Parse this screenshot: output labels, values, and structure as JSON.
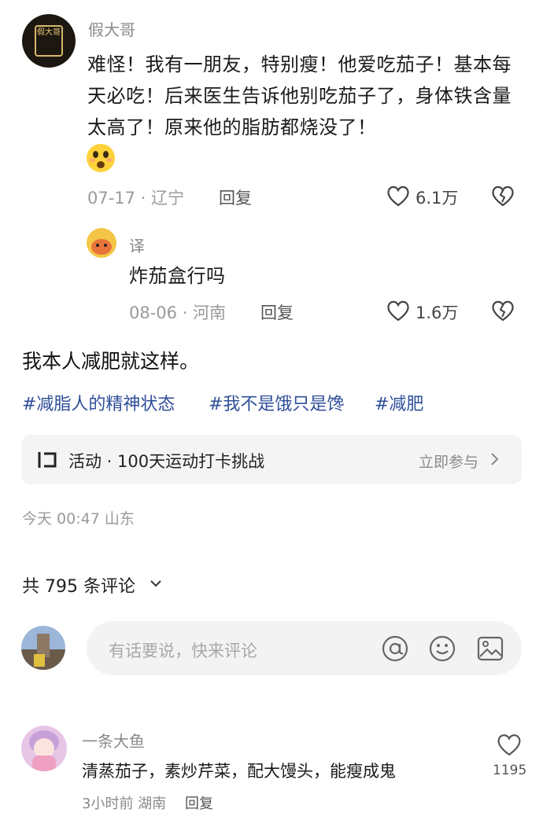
{
  "comment1": {
    "author": "假大哥",
    "avatar_text": "假大哥",
    "text": "难怪！我有一朋友，特别瘦！他爱吃茄子！基本每天必吃！后来医生告诉他别吃茄子了，身体铁含量太高了！原来他的脂肪都烧没了！",
    "emoji": "😳",
    "date": "07-17 · 辽宁",
    "reply_label": "回复",
    "like_count": "6.1万"
  },
  "reply1": {
    "author": "译",
    "text": "炸茄盒行吗",
    "date": "08-06 · 河南",
    "reply_label": "回复",
    "like_count": "1.6万"
  },
  "post": {
    "text": "我本人减肥就这样。",
    "tags": [
      "#减脂人的精神状态",
      "#我不是饿只是馋",
      "#减肥"
    ]
  },
  "activity": {
    "label": "活动 · 100天运动打卡挑战",
    "action": "立即参与"
  },
  "post_meta": "今天 00:47 山东",
  "comments_header": "共 795 条评论",
  "comment_input": {
    "placeholder": "有话要说，快来评论"
  },
  "comment2": {
    "author": "一条大鱼",
    "text": "清蒸茄子，素炒芹菜，配大馒头，能瘦成鬼",
    "meta": "3小时前 湖南",
    "reply_label": "回复",
    "like_count": "1195"
  },
  "colors": {
    "tag": "#2f4f99",
    "muted": "#9a9a9a",
    "banner_bg": "#f4f4f4"
  },
  "icons": [
    "heart-icon",
    "broken-heart-icon",
    "at-icon",
    "smile-icon",
    "image-icon",
    "chevron-down-icon",
    "chevron-right-icon",
    "activity-icon"
  ]
}
